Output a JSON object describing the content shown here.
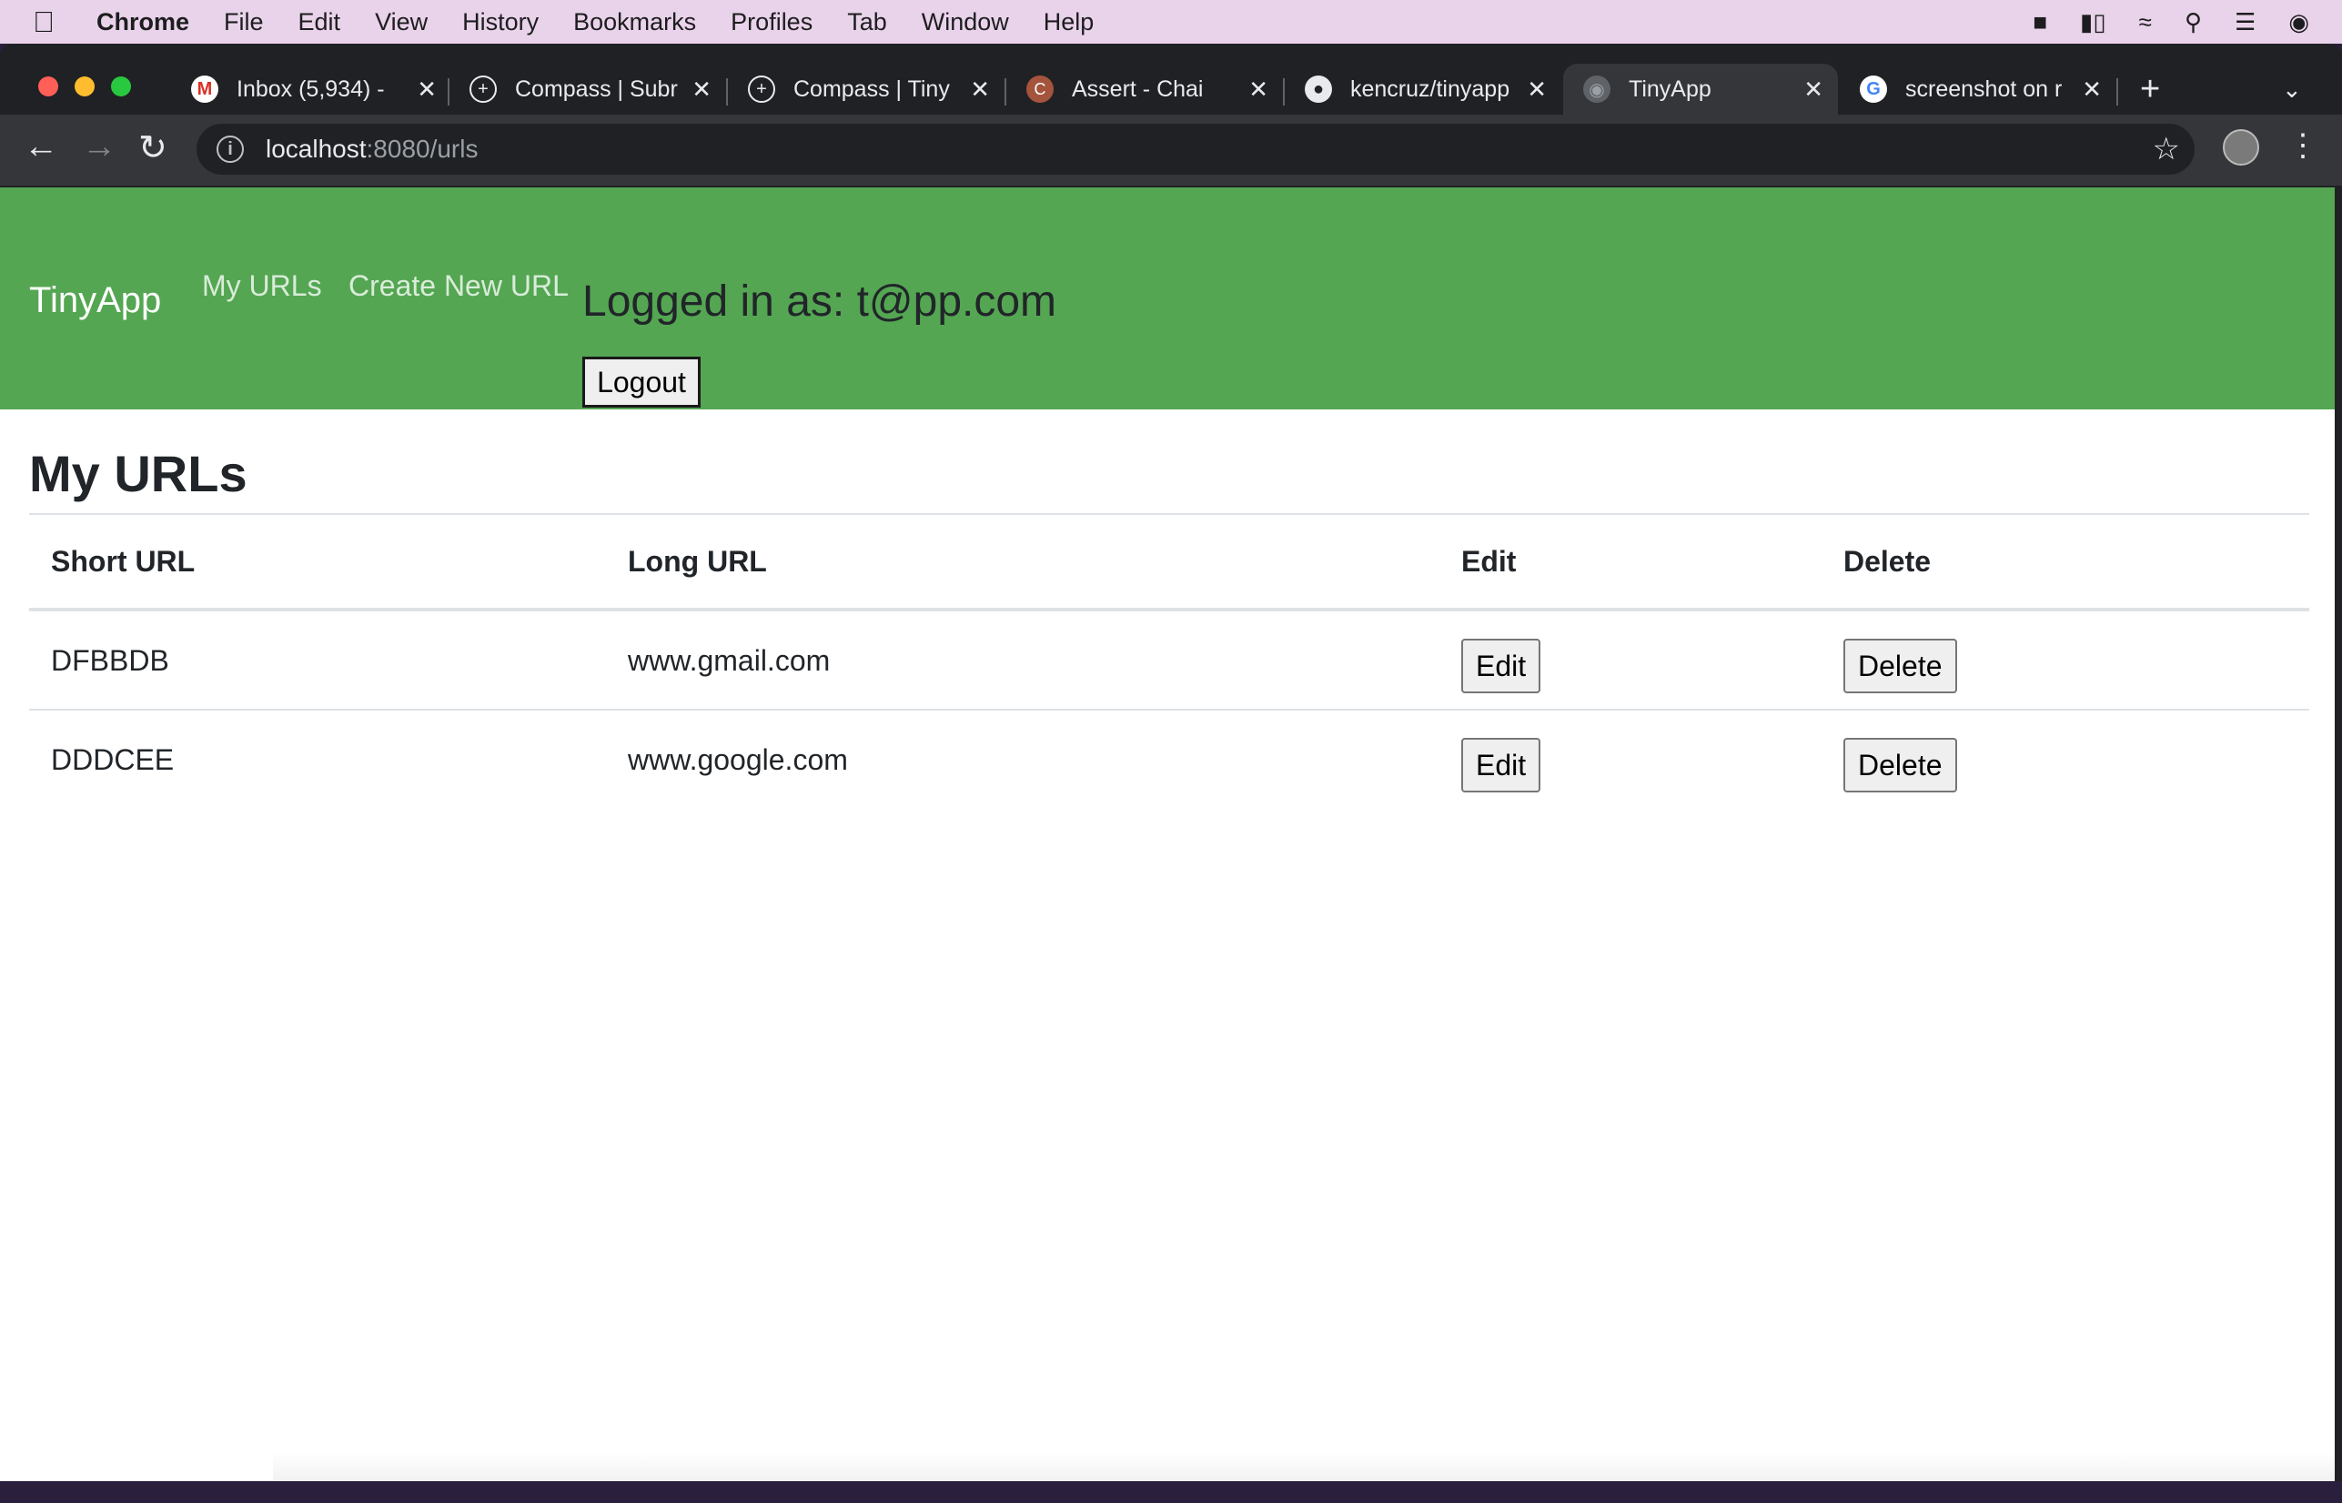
{
  "menubar": {
    "app_name": "Chrome",
    "items": [
      "File",
      "Edit",
      "View",
      "History",
      "Bookmarks",
      "Profiles",
      "Tab",
      "Window",
      "Help"
    ]
  },
  "tabs": [
    {
      "title": "Inbox (5,934) -",
      "icon": "gmail-icon"
    },
    {
      "title": "Compass | Subr",
      "icon": "compass-icon"
    },
    {
      "title": "Compass | Tiny",
      "icon": "compass-icon"
    },
    {
      "title": "Assert - Chai",
      "icon": "chai-icon"
    },
    {
      "title": "kencruz/tinyapp",
      "icon": "github-icon"
    },
    {
      "title": "TinyApp",
      "icon": "globe-icon",
      "active": true
    },
    {
      "title": "screenshot on r",
      "icon": "google-icon"
    }
  ],
  "address_bar": {
    "host": "localhost",
    "path": ":8080/urls"
  },
  "navbar": {
    "brand": "TinyApp",
    "links": [
      "My URLs",
      "Create New URL"
    ],
    "logged_in_text": "Logged in as: t@pp.com",
    "logout_label": "Logout"
  },
  "main": {
    "heading": "My URLs",
    "columns": [
      "Short URL",
      "Long URL",
      "Edit",
      "Delete"
    ],
    "rows": [
      {
        "short": "DFBBDB",
        "long": "www.gmail.com",
        "edit": "Edit",
        "delete": "Delete"
      },
      {
        "short": "DDDCEE",
        "long": "www.google.com",
        "edit": "Edit",
        "delete": "Delete"
      }
    ]
  },
  "colors": {
    "navbar": "#54a652",
    "menubar": "#e9d3ea"
  }
}
